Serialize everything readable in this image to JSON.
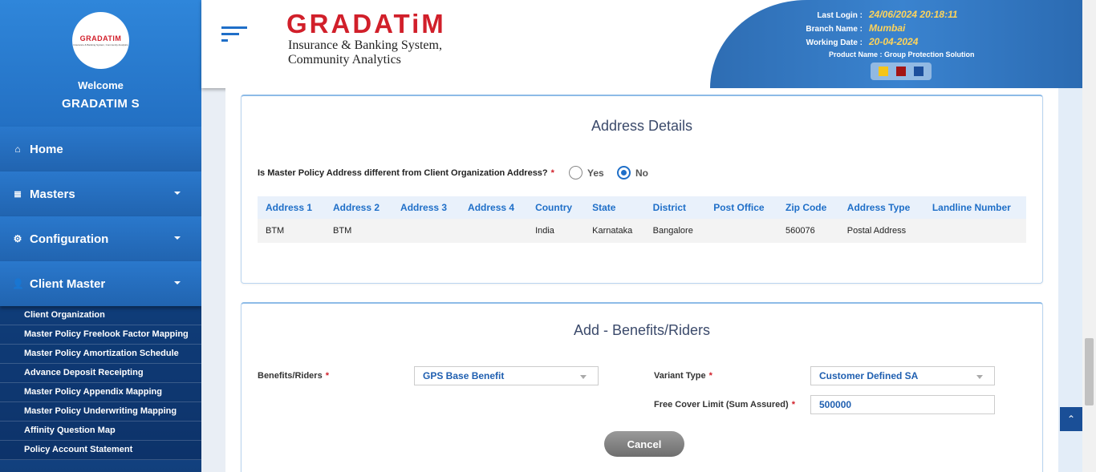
{
  "sidebar": {
    "logo_brand": "GRADATIM",
    "logo_sub": "Insurance & Banking System, Community Analytics",
    "welcome": "Welcome",
    "username": "GRADATIM S",
    "menu": [
      {
        "label": "Home",
        "icon": "home-icon"
      },
      {
        "label": "Masters",
        "icon": "database-icon"
      },
      {
        "label": "Configuration",
        "icon": "gears-icon"
      },
      {
        "label": "Client Master",
        "icon": "user-icon"
      }
    ],
    "submenu": [
      "Client Organization",
      "Master Policy Freelook Factor Mapping",
      "Master Policy Amortization Schedule",
      "Advance Deposit Receipting",
      "Master Policy Appendix Mapping",
      "Master Policy Underwriting Mapping",
      "Affinity Question Map",
      "Policy Account Statement"
    ]
  },
  "header": {
    "brand_name": "GRADATiM",
    "brand_tagline": "Insurance & Banking System, Community Analytics",
    "last_login_label": "Last Login :",
    "last_login_value": "24/06/2024 20:18:11",
    "branch_label": "Branch Name :",
    "branch_value": "Mumbai",
    "working_date_label": "Working Date :",
    "working_date_value": "20-04-2024",
    "product": "Product Name : Group Protection Solution",
    "theme_colors": [
      "#f5c518",
      "#a31515",
      "#1c4f9c"
    ]
  },
  "address": {
    "title": "Address Details",
    "question": "Is Master Policy Address different from Client Organization Address?",
    "required_mark": "*",
    "yes_label": "Yes",
    "no_label": "No",
    "selected": "No",
    "columns": [
      "Address 1",
      "Address 2",
      "Address 3",
      "Address 4",
      "Country",
      "State",
      "District",
      "Post Office",
      "Zip Code",
      "Address Type",
      "Landline Number"
    ],
    "row": [
      "BTM",
      "BTM",
      "",
      "",
      "India",
      "Karnataka",
      "Bangalore",
      "",
      "560076",
      "Postal Address",
      ""
    ]
  },
  "benefits": {
    "title": "Add - Benefits/Riders",
    "benefits_label": "Benefits/Riders",
    "benefits_value": "GPS Base Benefit",
    "variant_label": "Variant Type",
    "variant_value": "Customer Defined SA",
    "free_cover_label": "Free Cover Limit (Sum Assured)",
    "free_cover_value": "500000",
    "required_mark": "*",
    "cancel_label": "Cancel"
  },
  "controls": {
    "scroll_top_glyph": "⌃",
    "home_glyph": "⌂",
    "masters_glyph": "≣",
    "config_glyph": "⚙",
    "user_glyph": "👤"
  }
}
